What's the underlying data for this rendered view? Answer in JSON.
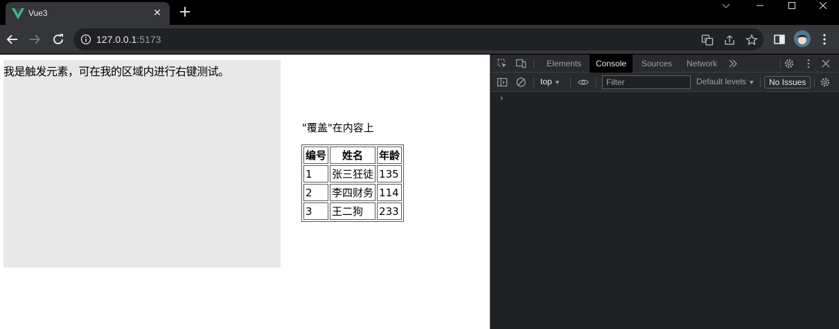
{
  "browser": {
    "tab_title": "Vue3",
    "tab_close": "✕",
    "new_tab": "+",
    "url_host": "127.0.0.1",
    "url_port": ":5173",
    "accent_color": "#42b883"
  },
  "page": {
    "trigger_text": "我是触发元素，可在我的区域内进行右键测试。",
    "overlay_text": "\"覆盖\"在内容上",
    "table": {
      "headers": [
        "编号",
        "姓名",
        "年龄"
      ],
      "rows": [
        [
          "1",
          "张三狂徒",
          "135"
        ],
        [
          "2",
          "李四财务",
          "114"
        ],
        [
          "3",
          "王二狗",
          "233"
        ]
      ]
    }
  },
  "devtools": {
    "tabs": [
      "Elements",
      "Console",
      "Sources",
      "Network"
    ],
    "active_tab": "Console",
    "context": "top",
    "filter_placeholder": "Filter",
    "levels": "Default levels",
    "issues": "No Issues",
    "prompt": "›"
  }
}
